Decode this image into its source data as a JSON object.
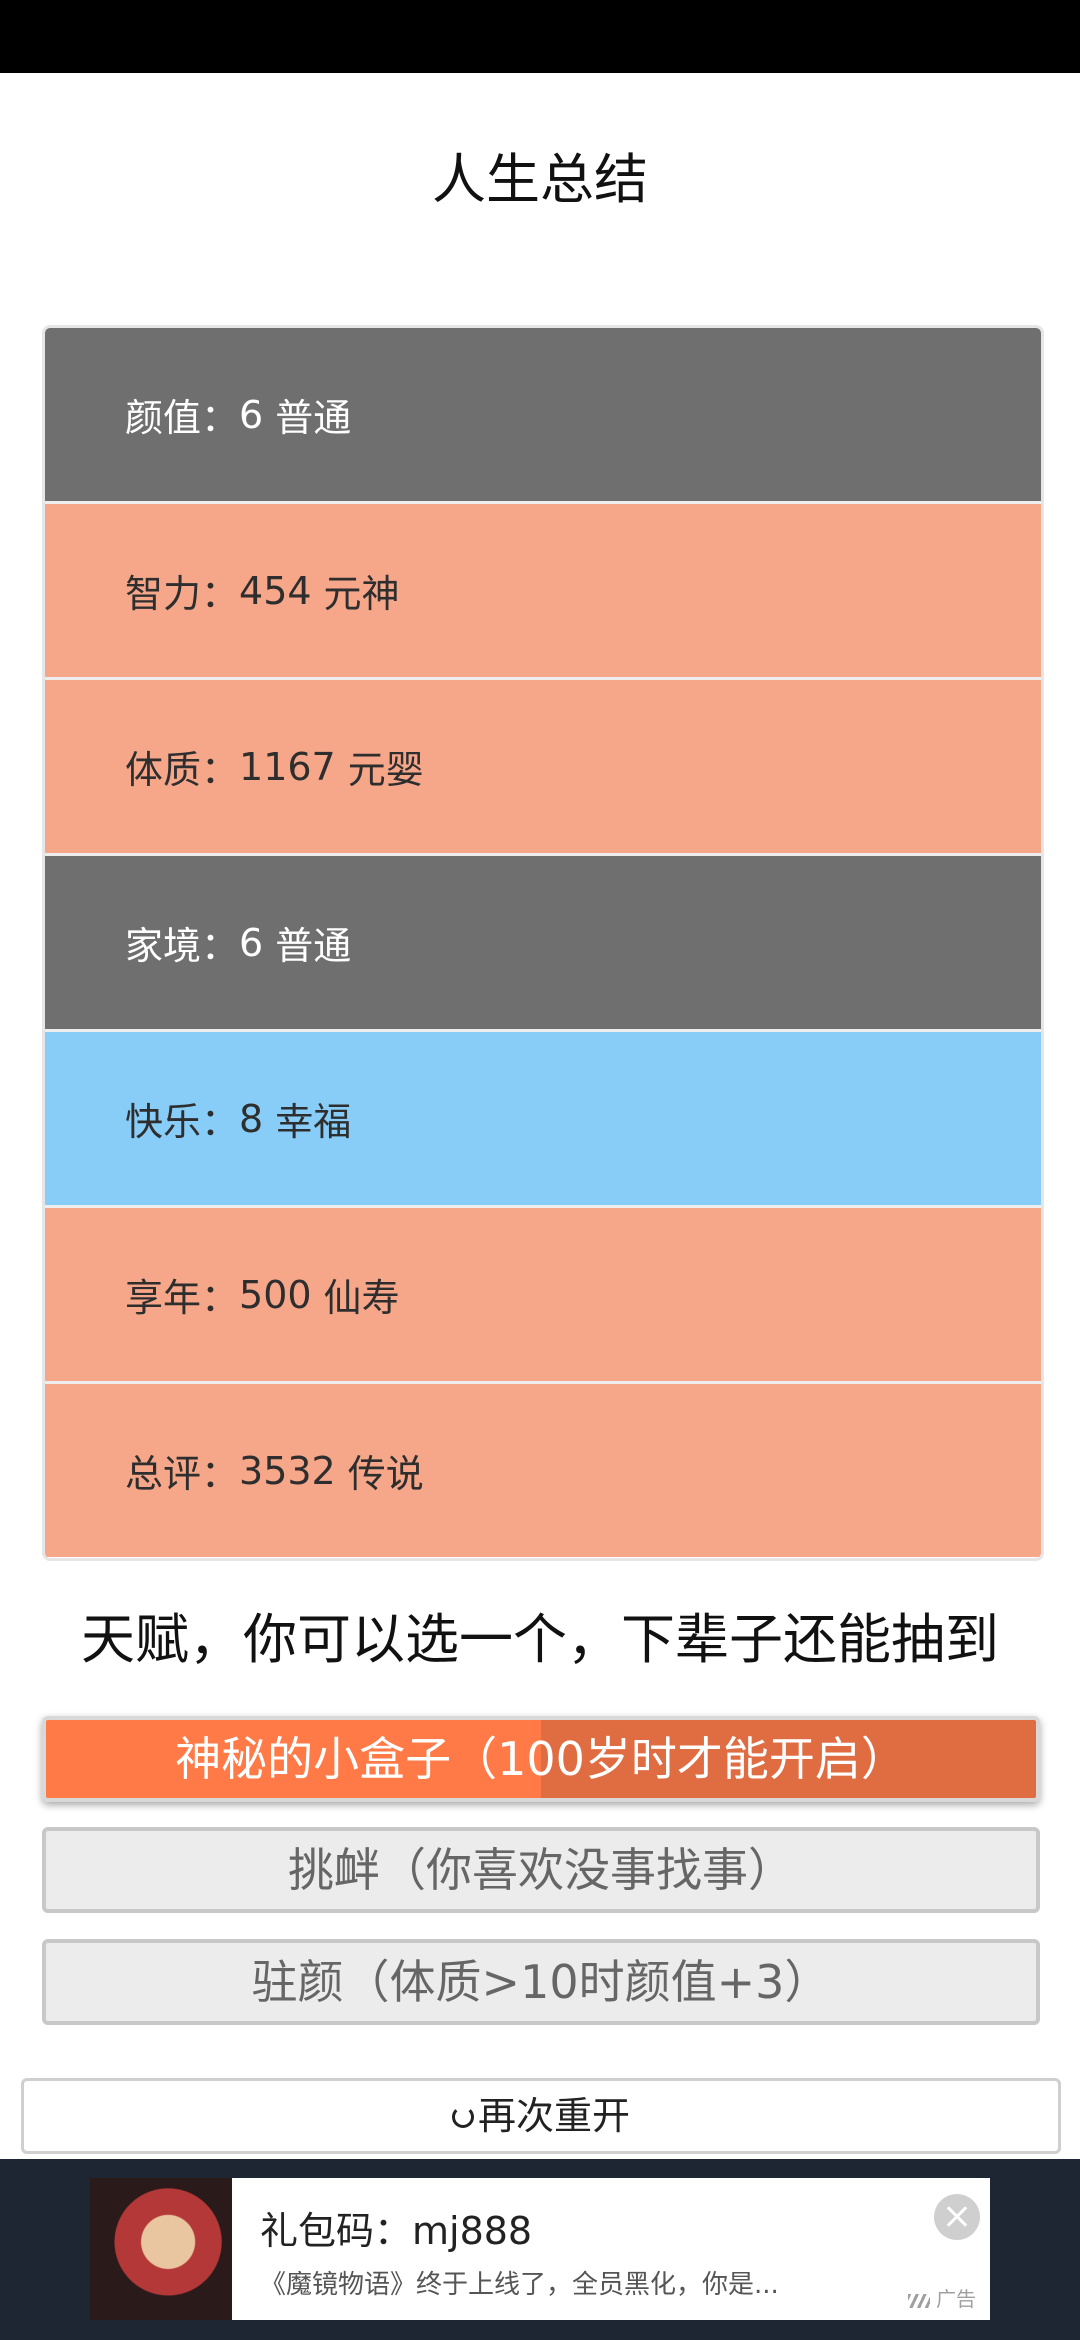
{
  "page": {
    "title": "人生总结",
    "talent_heading": "天赋，你可以选一个，下辈子还能抽到"
  },
  "stats": [
    {
      "label": "颜值：",
      "value": "6",
      "rank": "普通"
    },
    {
      "label": "智力：",
      "value": "454",
      "rank": "元神"
    },
    {
      "label": "体质：",
      "value": "1167",
      "rank": "元婴"
    },
    {
      "label": "家境：",
      "value": "6",
      "rank": "普通"
    },
    {
      "label": "快乐：",
      "value": "8",
      "rank": "幸福"
    },
    {
      "label": "享年：",
      "value": "500",
      "rank": "仙寿"
    },
    {
      "label": "总评：",
      "value": "3532",
      "rank": "传说"
    }
  ],
  "talents": [
    {
      "label": "神秘的小盒子（100岁时才能开启）",
      "selected": true
    },
    {
      "label": "挑衅（你喜欢没事找事）",
      "selected": false
    },
    {
      "label": "驻颜（体质>10时颜值+3）",
      "selected": false
    }
  ],
  "restart": {
    "label": "再次重开",
    "icon": "refresh-icon"
  },
  "ad": {
    "title": "礼包码：mj888",
    "description": "《魔镜物语》终于上线了，全员黑化，你是...",
    "tag": "广告",
    "close_icon": "close-icon",
    "image": "game-character-image"
  },
  "colors": {
    "normal": "#6f6f6f",
    "high": "#f6a78a",
    "happy": "#87cdf8",
    "selected_talent": "#ff7a47",
    "ad_background": "#1f2633"
  }
}
